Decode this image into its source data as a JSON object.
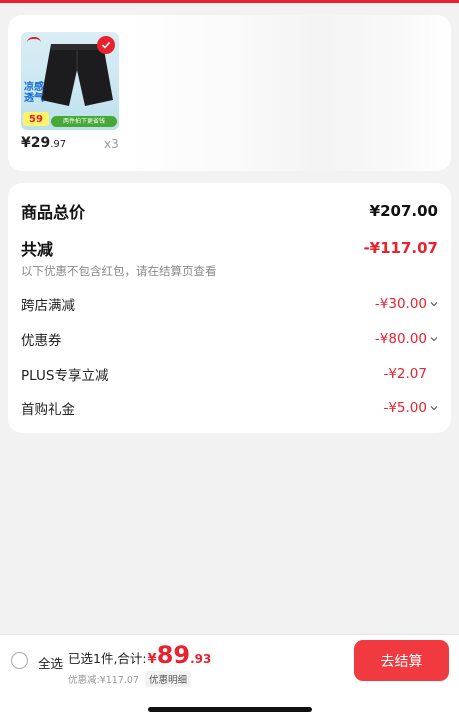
{
  "product": {
    "image_promo_text": "凉感透气",
    "image_price_tag": "59",
    "image_banner": "两件拍下更省钱",
    "price_int": "¥29",
    "price_dec": ".97",
    "quantity": "x3"
  },
  "summary": {
    "total_label": "商品总价",
    "total_value": "¥207.00",
    "reduce_label": "共减",
    "reduce_value": "-¥117.07",
    "note": "以下优惠不包含红包，请在结算页查看",
    "items": [
      {
        "label": "跨店满减",
        "value": "-¥30.00",
        "has_chevron": true
      },
      {
        "label": "优惠券",
        "value": "-¥80.00",
        "has_chevron": true
      },
      {
        "label": "PLUS专享立减",
        "value": "-¥2.07",
        "has_chevron": false
      },
      {
        "label": "首购礼金",
        "value": "-¥5.00",
        "has_chevron": true
      }
    ]
  },
  "bottom_bar": {
    "select_all_label": "全选",
    "selected_text": "已选1件,合计:",
    "yen": "¥",
    "total_int": "89",
    "total_dec": ".93",
    "discount_text": "优惠减:¥117.07",
    "detail_label": "优惠明细",
    "checkout_label": "去结算"
  },
  "colors": {
    "accent_red": "#e8232e",
    "checkout_button": "#f03a3f"
  }
}
